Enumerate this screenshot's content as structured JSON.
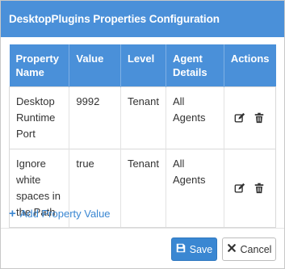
{
  "dialog": {
    "title": "DesktopPlugins Properties Configuration"
  },
  "table": {
    "headers": {
      "property_name": "Property Name",
      "value": "Value",
      "level": "Level",
      "agent_details": "Agent Details",
      "actions": "Actions"
    },
    "rows": [
      {
        "property_name": "Desktop Runtime Port",
        "value": "9992",
        "level": "Tenant",
        "agent_details": "All Agents"
      },
      {
        "property_name": "Ignore white spaces in the Path",
        "value": "true",
        "level": "Tenant",
        "agent_details": "All Agents"
      }
    ]
  },
  "add_property": {
    "label": "Add Property Value"
  },
  "footer": {
    "save_label": "Save",
    "cancel_label": "Cancel"
  },
  "icons": {
    "add": "plus-icon",
    "edit": "edit-icon",
    "delete": "trash-icon",
    "save": "floppy-disk-icon",
    "cancel": "times-icon"
  },
  "colors": {
    "primary": "#4a90d9",
    "link": "#3a87d2"
  }
}
